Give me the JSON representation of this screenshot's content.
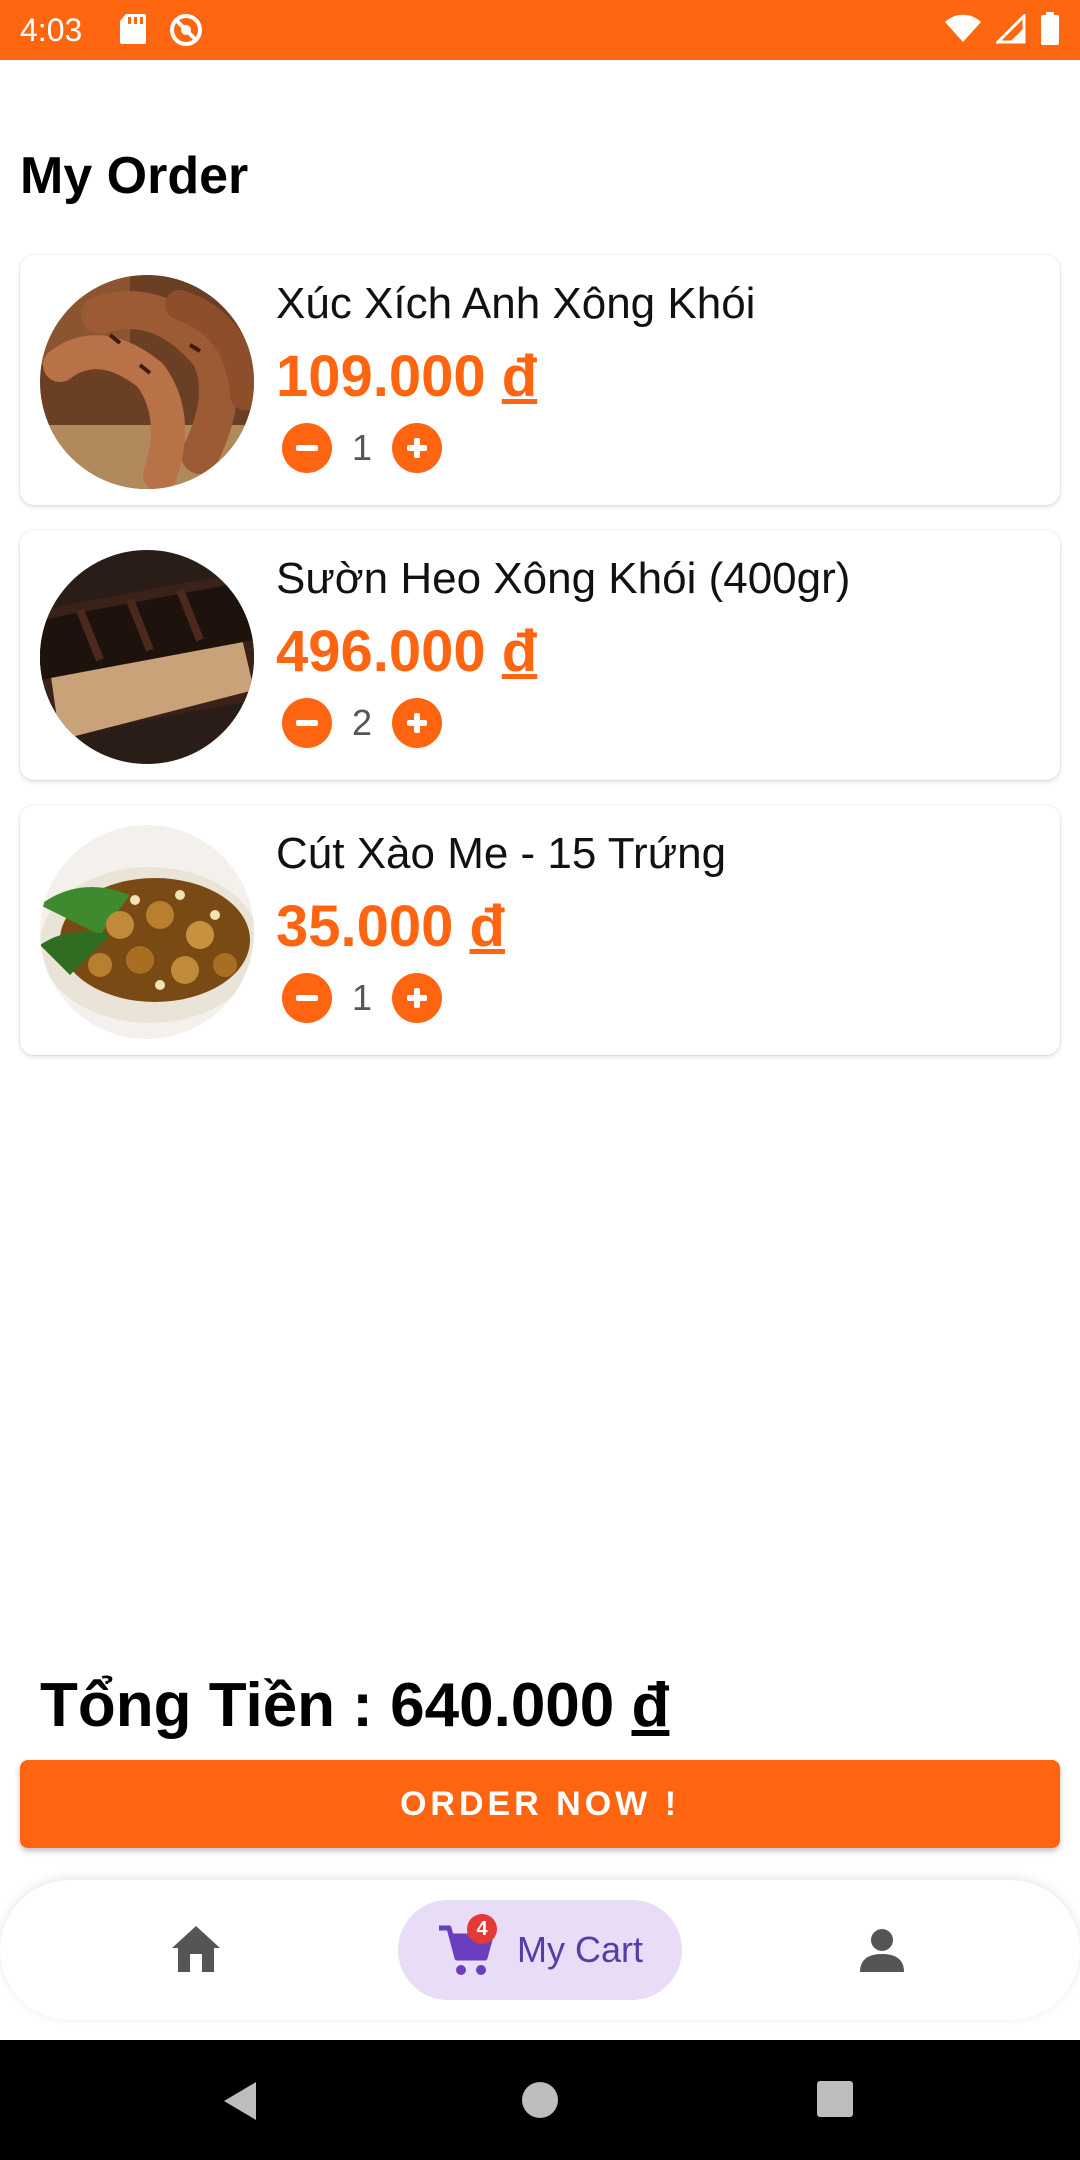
{
  "status_bar": {
    "time": "4:03"
  },
  "page": {
    "title": "My Order"
  },
  "orders": [
    {
      "name": "Xúc Xích Anh Xông Khói",
      "price": "109.000",
      "currency": "đ",
      "quantity": "1",
      "image": "sausage-photo"
    },
    {
      "name": "Sườn Heo Xông Khói (400gr)",
      "price": "496.000",
      "currency": "đ",
      "quantity": "2",
      "image": "smoked-ribs-photo"
    },
    {
      "name": "Cút Xào Me - 15 Trứng",
      "price": "35.000",
      "currency": "đ",
      "quantity": "1",
      "image": "quail-eggs-photo"
    }
  ],
  "summary": {
    "total_label": "Tổng Tiền : 640.000",
    "currency": "đ"
  },
  "actions": {
    "order_now": "ORDER NOW !"
  },
  "bottom_nav": {
    "cart_label": "My Cart",
    "cart_badge": "4"
  },
  "colors": {
    "accent": "#ff6410",
    "nav_active_bg": "#e8dcf7",
    "nav_active_text": "#5a3aa8",
    "badge": "#e53935"
  }
}
